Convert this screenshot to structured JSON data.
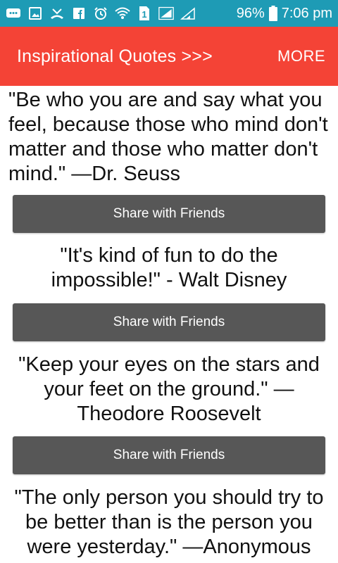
{
  "status_bar": {
    "battery": "96%",
    "time": "7:06 pm",
    "icons": [
      "chat-icon",
      "image-icon",
      "missed-call-icon",
      "facebook-icon",
      "alarm-icon",
      "wifi-icon",
      "sim1-icon",
      "signal-icon",
      "signal-icon",
      "battery-icon"
    ]
  },
  "app_bar": {
    "title": "Inspirational Quotes >>>",
    "more": "MORE"
  },
  "quotes": [
    {
      "text": "\"Be who you are and say what you feel, because those who mind don't matter and those who matter don't mind.\"  —Dr. Seuss",
      "button": "Share with Friends"
    },
    {
      "text": "\"It's kind of fun to do the impossible!\" - Walt Disney",
      "button": "Share with Friends"
    },
    {
      "text": "\"Keep your eyes on the stars and your feet on the ground.\"  — Theodore Roosevelt",
      "button": "Share with Friends"
    },
    {
      "text": "\"The only person you should try to be better than is the person you were yesterday.\"  —Anonymous",
      "button": ""
    }
  ],
  "colors": {
    "status_bar": "#1e9bb5",
    "app_bar": "#f44336",
    "button": "#575757"
  }
}
